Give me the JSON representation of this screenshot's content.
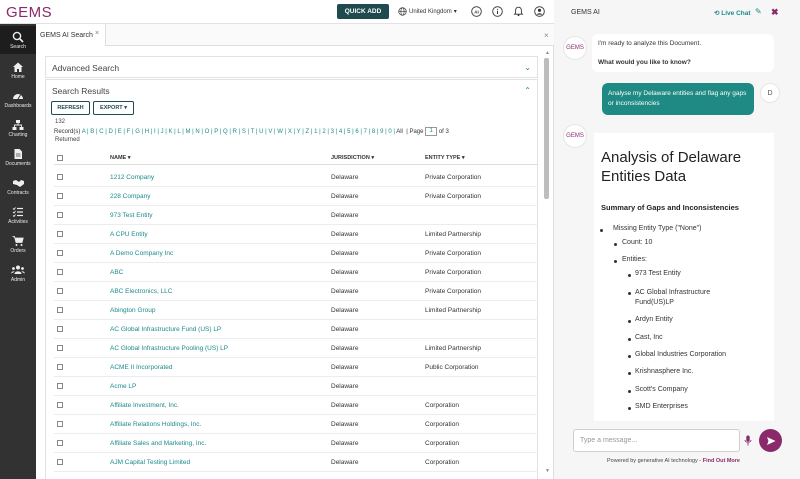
{
  "app": {
    "logo": "GEMS",
    "quick_add": "QUICK ADD",
    "country": "United Kingdom",
    "accent": "#8a2a6b",
    "teal": "#1d8a8a"
  },
  "sidebar": {
    "items": [
      {
        "label": "Search",
        "icon": "search-icon"
      },
      {
        "label": "Home",
        "icon": "home-icon"
      },
      {
        "label": "Dashboards",
        "icon": "dashboard-icon"
      },
      {
        "label": "Charting",
        "icon": "org-chart-icon"
      },
      {
        "label": "Documents",
        "icon": "document-icon"
      },
      {
        "label": "Contracts",
        "icon": "handshake-icon"
      },
      {
        "label": "Activities",
        "icon": "checklist-icon"
      },
      {
        "label": "Orders",
        "icon": "cart-icon"
      },
      {
        "label": "Admin",
        "icon": "users-icon"
      }
    ]
  },
  "main": {
    "tab_label": "GEMS AI Search",
    "tab_close": "×",
    "close": "×",
    "advanced_search": "Advanced Search",
    "search_results": "Search Results",
    "refresh": "REFRESH",
    "export": "EXPORT ▾",
    "records_count": "132",
    "records_label": "Record(s)",
    "returned": "Returned",
    "alphabet": [
      "A",
      "B",
      "C",
      "D",
      "E",
      "F",
      "G",
      "H",
      "I",
      "J",
      "K",
      "L",
      "M",
      "N",
      "O",
      "P",
      "Q",
      "R",
      "S",
      "T",
      "U",
      "V",
      "W",
      "X",
      "Y",
      "Z",
      "1",
      "2",
      "3",
      "4",
      "5",
      "6",
      "7",
      "8",
      "9",
      "0",
      "All"
    ],
    "page_label": "Page",
    "page_value": "1",
    "page_of": "of",
    "page_total": "3",
    "columns": {
      "name": "NAME ▾",
      "jurisdiction": "JURISDICTION ▾",
      "entity_type": "ENTITY TYPE ▾"
    },
    "rows": [
      {
        "name": "1212 Company",
        "jurisdiction": "Delaware",
        "entity_type": "Private Corporation"
      },
      {
        "name": "228 Company",
        "jurisdiction": "Delaware",
        "entity_type": "Private Corporation"
      },
      {
        "name": "973 Test Entity",
        "jurisdiction": "Delaware",
        "entity_type": ""
      },
      {
        "name": "A CPU Entity",
        "jurisdiction": "Delaware",
        "entity_type": "Limited Partnership"
      },
      {
        "name": "A Demo Company Inc",
        "jurisdiction": "Delaware",
        "entity_type": "Private Corporation"
      },
      {
        "name": "ABC",
        "jurisdiction": "Delaware",
        "entity_type": "Private Corporation"
      },
      {
        "name": "ABC Electronics, LLC",
        "jurisdiction": "Delaware",
        "entity_type": "Private Corporation"
      },
      {
        "name": "Abington Group",
        "jurisdiction": "Delaware",
        "entity_type": "Limited Partnership"
      },
      {
        "name": "AC Global Infrastructure Fund (US) LP",
        "jurisdiction": "Delaware",
        "entity_type": ""
      },
      {
        "name": "AC Global Infrastructure Pooling (US) LP",
        "jurisdiction": "Delaware",
        "entity_type": "Limited Partnership"
      },
      {
        "name": "ACME II Incorporated",
        "jurisdiction": "Delaware",
        "entity_type": "Public Corporation"
      },
      {
        "name": "Acme LP",
        "jurisdiction": "Delaware",
        "entity_type": ""
      },
      {
        "name": "Affiliate Investment, Inc.",
        "jurisdiction": "Delaware",
        "entity_type": "Corporation"
      },
      {
        "name": "Affiliate Relations Holdings, Inc.",
        "jurisdiction": "Delaware",
        "entity_type": "Corporation"
      },
      {
        "name": "Affiliate Sales and Marketing, Inc.",
        "jurisdiction": "Delaware",
        "entity_type": "Corporation"
      },
      {
        "name": "AJM Capital Testing Limited",
        "jurisdiction": "Delaware",
        "entity_type": "Corporation"
      }
    ]
  },
  "chat": {
    "title": "GEMS AI",
    "live_chat": "Live Chat",
    "close": "✖",
    "bot_avatar": "GEMS",
    "user_avatar": "D",
    "bot_msg_1": "I'm ready to analyze this Document.",
    "bot_msg_2": "What would you like to know?",
    "user_msg": "Analyse my Delaware entities and flag any gaps or inconsistencies",
    "answer_title": "Analysis of Delaware Entities Data",
    "answer_subtitle": "Summary of Gaps and Inconsistencies",
    "missing_type": "Missing Entity Type (\"None\")",
    "count": "Count: 10",
    "entities_label": "Entities:",
    "entities": [
      "973 Test Entity",
      "AC Global Infrastructure Fund(US)LP",
      "Ardyn Entity",
      "Cast, Inc",
      "Global Industries Corporation",
      "Krishnasphere Inc.",
      "Scott's Company",
      "SMD Enterprises"
    ],
    "input_placeholder": "Type a message...",
    "footer_text": "Powered by generative AI technology -",
    "footer_link": "Find Out More"
  }
}
